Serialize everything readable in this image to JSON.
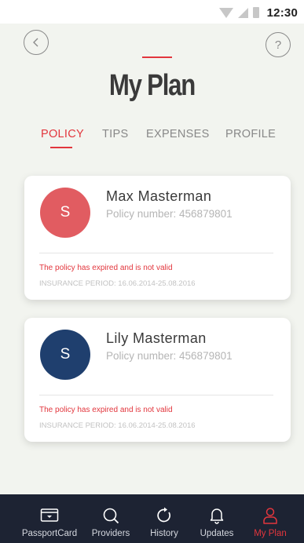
{
  "status_bar": {
    "time": "12:30"
  },
  "header": {
    "back_icon": "chevron-left-icon",
    "help_label": "?",
    "title": "My Plan"
  },
  "tabs": [
    {
      "label": "POLICY",
      "active": true
    },
    {
      "label": "TIPS",
      "active": false
    },
    {
      "label": "EXPENSES",
      "active": false
    },
    {
      "label": "PROFILE",
      "active": false
    }
  ],
  "policies": [
    {
      "initial": "S",
      "avatar_color": "#e15c61",
      "name": "Max Masterman",
      "policy_number": "Policy number: 456879801",
      "status": "The policy has expired and is not valid",
      "period": "INSURANCE PERIOD:  16.06.2014-25.08.2016"
    },
    {
      "initial": "S",
      "avatar_color": "#1f3f6e",
      "name": "Lily Masterman",
      "policy_number": "Policy number: 456879801",
      "status": "The policy has expired and is not valid",
      "period": "INSURANCE PERIOD:  16.06.2014-25.08.2016"
    }
  ],
  "bottom_nav": [
    {
      "label": "PassportCard",
      "icon": "card-icon",
      "active": false
    },
    {
      "label": "Providers",
      "icon": "search-icon",
      "active": false
    },
    {
      "label": "History",
      "icon": "refresh-icon",
      "active": false
    },
    {
      "label": "Updates",
      "icon": "bell-icon",
      "active": false
    },
    {
      "label": "My Plan",
      "icon": "user-icon",
      "active": true
    }
  ],
  "colors": {
    "accent": "#e2363d",
    "background": "#f2f4ef",
    "nav_background": "#1d2333"
  }
}
